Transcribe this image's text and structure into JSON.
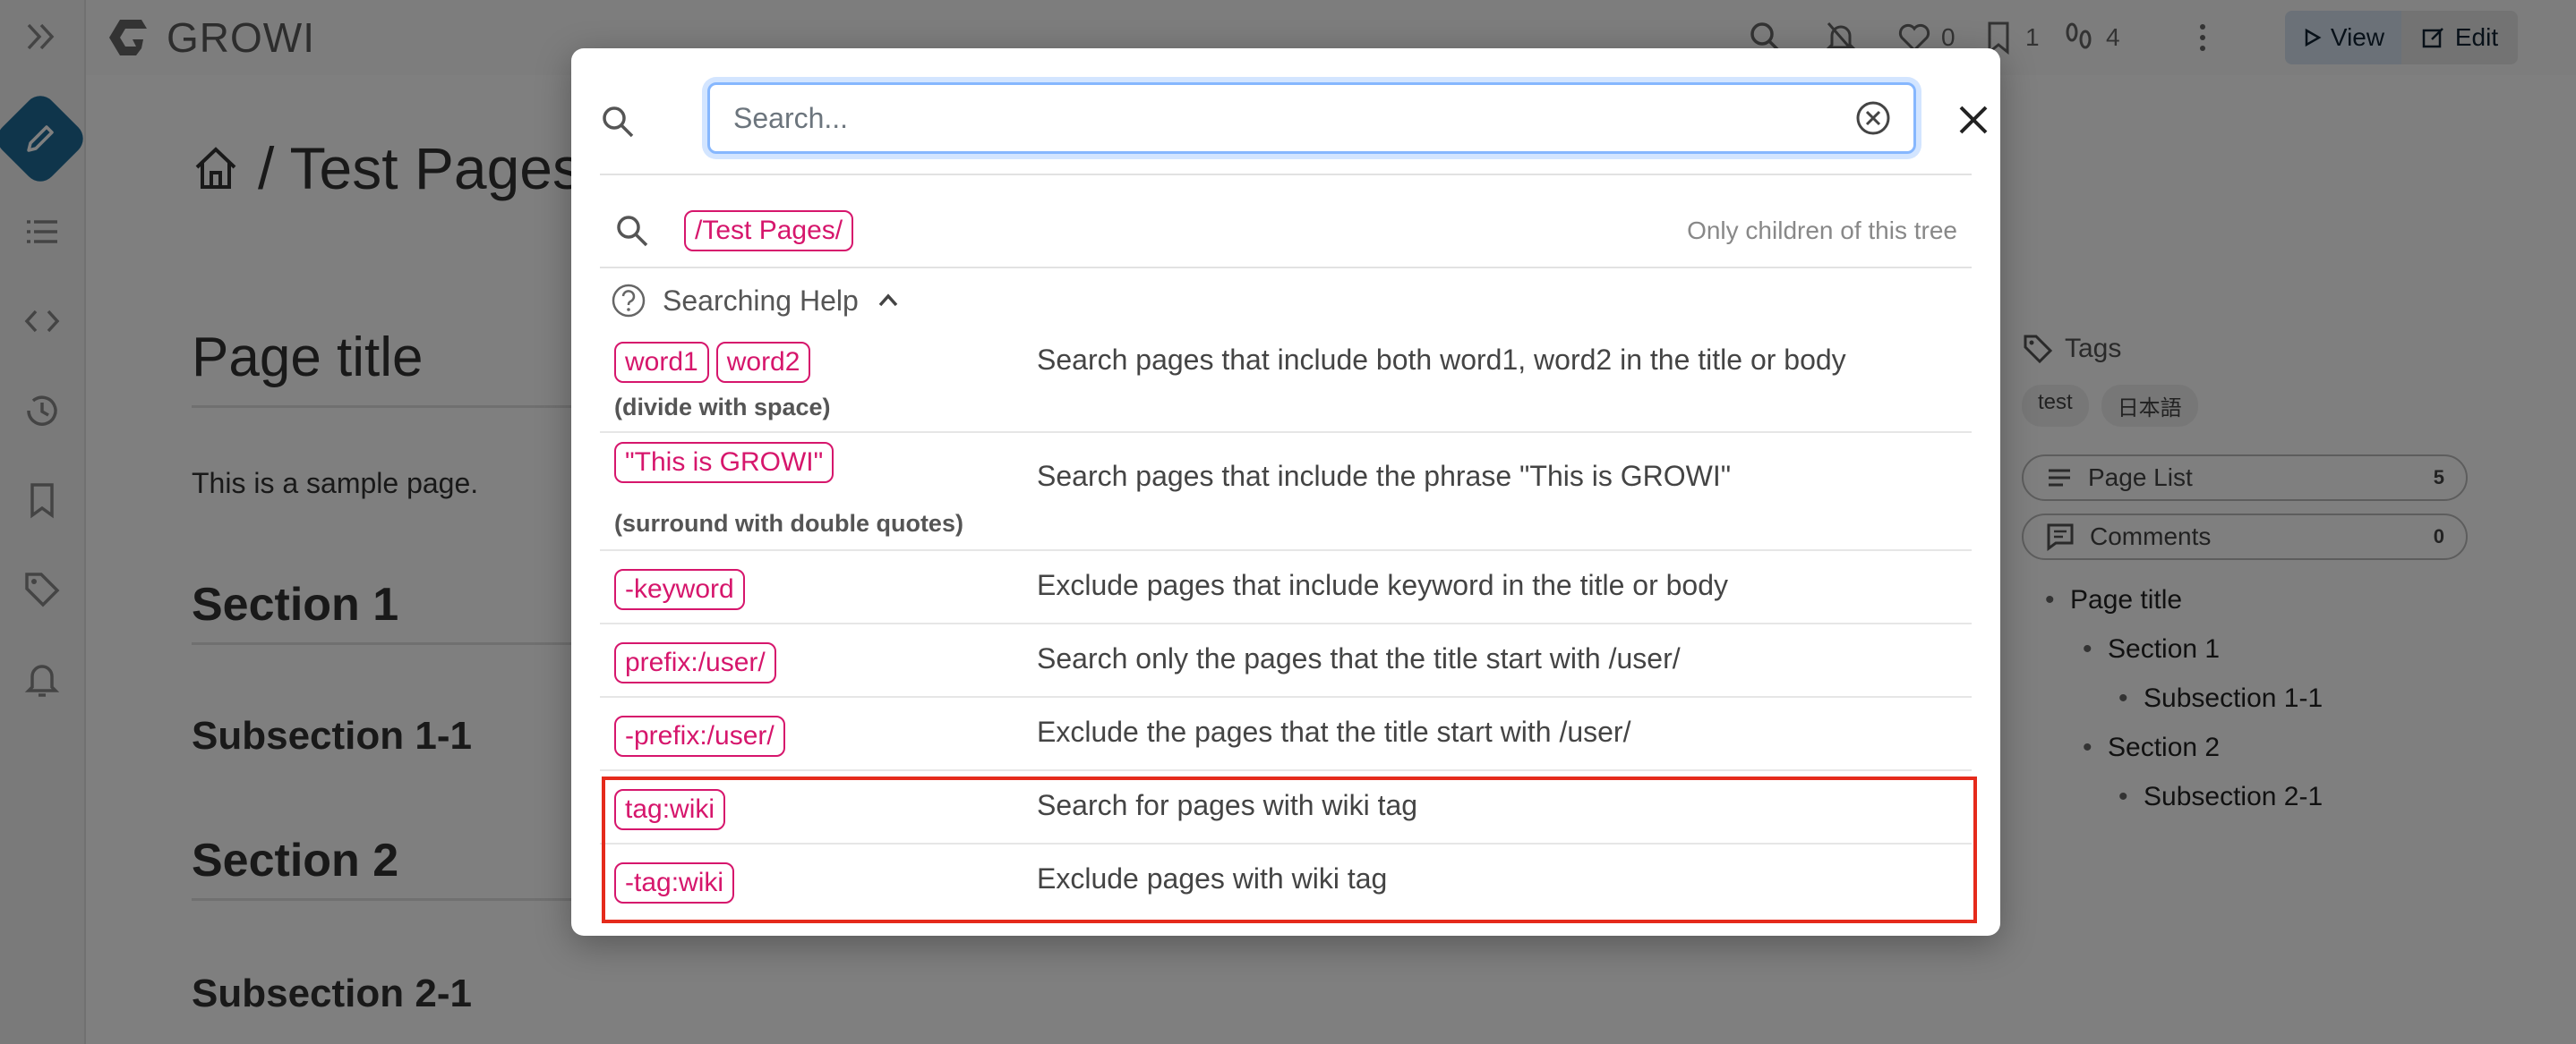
{
  "app": {
    "brand": "GROWI",
    "nav": {
      "like_count": "0",
      "bookmark_count": "1",
      "seen_count": "4",
      "view_label": "View",
      "edit_label": "Edit"
    }
  },
  "page": {
    "breadcrumb": "/ Test Pages",
    "title": "Page title",
    "body": "This is a sample page.",
    "section1": "Section 1",
    "subsection11": "Subsection 1-1",
    "section2": "Section 2",
    "subsection21": "Subsection 2-1"
  },
  "right_panel": {
    "tags_label": "Tags",
    "tags": [
      "test",
      "日本語"
    ],
    "page_list_label": "Page List",
    "page_list_count": "5",
    "comments_label": "Comments",
    "comments_count": "0",
    "toc": [
      "Page title",
      "Section 1",
      "Subsection 1-1",
      "Section 2",
      "Subsection 2-1"
    ]
  },
  "search_modal": {
    "placeholder": "Search...",
    "prefix_tag": "/Test Pages/",
    "prefix_note": "Only children of this tree",
    "help_title": "Searching Help",
    "rows": [
      {
        "syntax": [
          "word1",
          "word2"
        ],
        "note": "(divide with space)",
        "desc": "Search pages that include both word1, word2 in the title or body"
      },
      {
        "syntax": [
          "\"This is GROWI\""
        ],
        "note": "(surround with double quotes)",
        "desc": "Search pages that include the phrase \"This is GROWI\""
      },
      {
        "syntax": [
          "-keyword"
        ],
        "note": "",
        "desc": "Exclude pages that include keyword in the title or body"
      },
      {
        "syntax": [
          "prefix:/user/"
        ],
        "note": "",
        "desc": "Search only the pages that the title start with /user/"
      },
      {
        "syntax": [
          "-prefix:/user/"
        ],
        "note": "",
        "desc": "Exclude the pages that the title start with /user/"
      },
      {
        "syntax": [
          "tag:wiki"
        ],
        "note": "",
        "desc": "Search for pages with wiki tag"
      },
      {
        "syntax": [
          "-tag:wiki"
        ],
        "note": "",
        "desc": "Exclude pages with wiki tag"
      }
    ]
  },
  "colors": {
    "accent_pink": "#d6166c",
    "highlight_red": "#e52a1b",
    "edit_fab": "#1e6b96"
  }
}
